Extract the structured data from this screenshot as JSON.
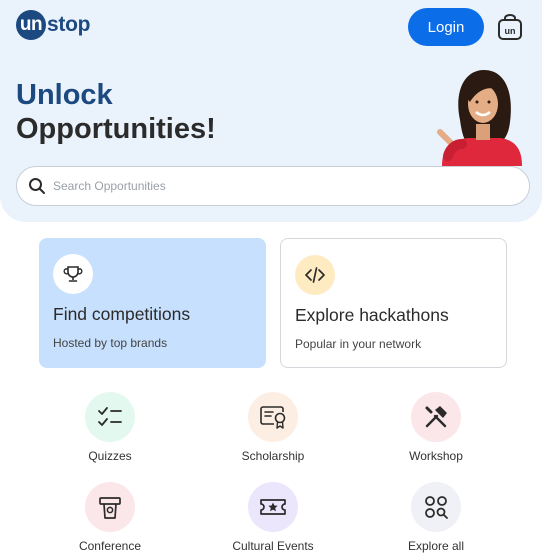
{
  "header": {
    "logo_mark": "un",
    "logo_rest": "stop",
    "login_label": "Login",
    "brand_color": "#1c4980",
    "accent_color": "#0b6de8",
    "bag_icon": "un-bag-icon"
  },
  "hero": {
    "headline_line1": "Unlock",
    "headline_line2": "Opportunities!"
  },
  "search": {
    "placeholder": "Search Opportunities",
    "value": ""
  },
  "cards": {
    "competitions": {
      "title": "Find competitions",
      "subtitle": "Hosted by top brands",
      "icon": "trophy-icon"
    },
    "hackathons": {
      "title": "Explore hackathons",
      "subtitle": "Popular in your network",
      "icon": "code-icon"
    }
  },
  "categories": [
    {
      "label": "Quizzes",
      "icon": "checklist-icon"
    },
    {
      "label": "Scholarship",
      "icon": "certificate-icon"
    },
    {
      "label": "Workshop",
      "icon": "tools-icon"
    },
    {
      "label": "Conference",
      "icon": "podium-icon"
    },
    {
      "label": "Cultural Events",
      "icon": "ticket-icon"
    },
    {
      "label": "Explore all",
      "icon": "grid-search-icon"
    }
  ]
}
